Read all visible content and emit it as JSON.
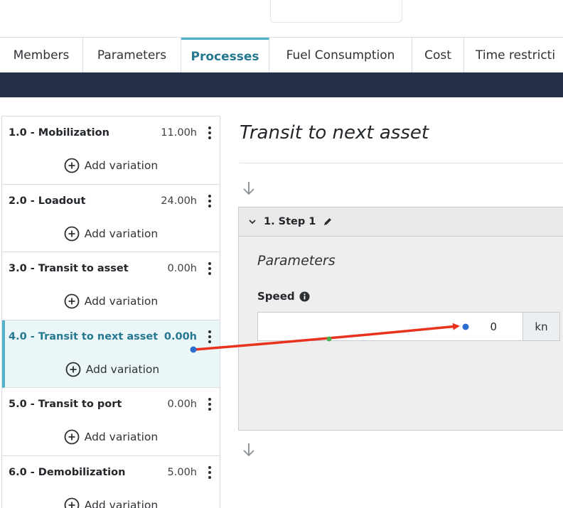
{
  "tabs": [
    {
      "label": "Members"
    },
    {
      "label": "Parameters"
    },
    {
      "label": "Processes"
    },
    {
      "label": "Fuel Consumption"
    },
    {
      "label": "Cost"
    },
    {
      "label": "Time restricti"
    }
  ],
  "sidebar": {
    "add_variation_label": "Add variation",
    "processes": [
      {
        "name": "1.0 - Mobilization",
        "hours": "11.00h"
      },
      {
        "name": "2.0 - Loadout",
        "hours": "24.00h"
      },
      {
        "name": "3.0 - Transit to asset",
        "hours": "0.00h"
      },
      {
        "name": "4.0 - Transit to next asset",
        "hours": "0.00h"
      },
      {
        "name": "5.0 - Transit to port",
        "hours": "0.00h"
      },
      {
        "name": "6.0 - Demobilization",
        "hours": "5.00h"
      }
    ]
  },
  "main": {
    "title": "Transit to next asset",
    "step": {
      "title": "1. Step 1",
      "parameters_title": "Parameters",
      "speed_label": "Speed",
      "speed_value": "0",
      "speed_unit": "kn"
    }
  },
  "colors": {
    "accent": "#25788f",
    "tab_indicator": "#4fb3c7",
    "navbar": "#243047",
    "annotation_arrow": "#e8321e"
  }
}
